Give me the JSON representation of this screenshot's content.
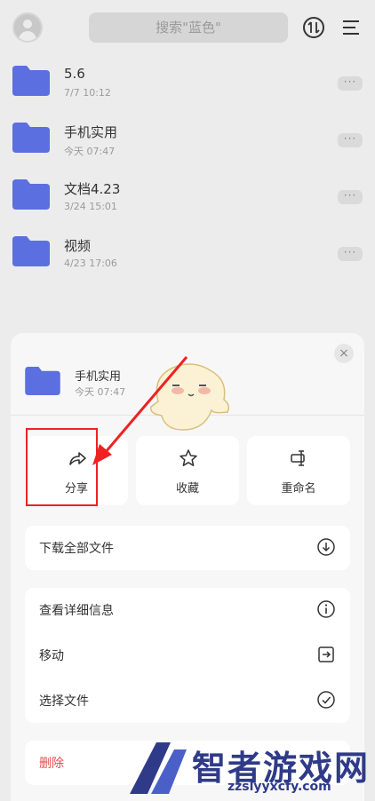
{
  "header": {
    "search_placeholder": "搜索\"蓝色\""
  },
  "files": [
    {
      "name": "5.6",
      "date": "7/7 10:12"
    },
    {
      "name": "手机实用",
      "date": "今天 07:47"
    },
    {
      "name": "文档4.23",
      "date": "3/24 15:01"
    },
    {
      "name": "视频",
      "date": "4/23 17:06"
    }
  ],
  "sheet": {
    "folder_name": "手机实用",
    "folder_date": "今天 07:47",
    "close_symbol": "×",
    "actions": [
      {
        "label": "分享",
        "icon": "share-icon"
      },
      {
        "label": "收藏",
        "icon": "star-icon"
      },
      {
        "label": "重命名",
        "icon": "rename-icon"
      }
    ],
    "download_all": "下载全部文件",
    "details": "查看详细信息",
    "move": "移动",
    "select_files": "选择文件",
    "delete": "删除"
  },
  "watermark": {
    "title": "智者游戏网",
    "url": "zzslyyxcfy.com"
  },
  "colors": {
    "folder": "#5b6fe0",
    "highlight": "#e22222",
    "danger": "#e05050",
    "watermark": "#2f3b88"
  }
}
